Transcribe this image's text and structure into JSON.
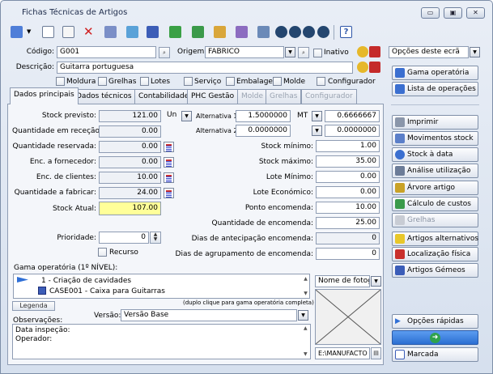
{
  "window": {
    "title": "Fichas Técnicas de Artigos",
    "btn_min": "▭",
    "btn_max": "▣",
    "btn_close": "✕"
  },
  "header": {
    "codigo_label": "Código:",
    "codigo_value": "G001",
    "origem_label": "Origem:",
    "origem_value": "FABRICO",
    "inativo_label": "Inativo",
    "descricao_label": "Descrição:",
    "descricao_value": "Guitarra portuguesa"
  },
  "flags": [
    "Moldura",
    "Grelhas",
    "Lotes",
    "Serviço",
    "Embalagem",
    "Molde",
    "Configurador"
  ],
  "tabs": [
    "Dados principais",
    "Dados técnicos",
    "Contabilidade",
    "PHC Gestão",
    "Molde",
    "Grelhas",
    "Configurador"
  ],
  "left_fields": [
    {
      "label": "Stock previsto:",
      "value": "121.00"
    },
    {
      "label": "Quantidade em receção:",
      "value": "0.00"
    },
    {
      "label": "Quantidade reservada:",
      "value": "0.00"
    },
    {
      "label": "Enc. a fornecedor:",
      "value": "0.00"
    },
    {
      "label": "Enc. de clientes:",
      "value": "10.00"
    },
    {
      "label": "Quantidade a fabricar:",
      "value": "24.00"
    },
    {
      "label": "Stock Atual:",
      "value": "107.00"
    }
  ],
  "unit": {
    "value": "Un",
    "alt1_label": "Alternativa 1:",
    "alt1_value": "1.5000000",
    "alt1_unit": "MT",
    "alt1_factor": "0.6666667",
    "alt2_label": "Alternativa 2:",
    "alt2_value": "0.0000000",
    "alt2_factor": "0.0000000"
  },
  "right_fields": [
    {
      "label": "Stock mínimo:",
      "value": "1.00"
    },
    {
      "label": "Stock máximo:",
      "value": "35.00"
    },
    {
      "label": "Lote Mínimo:",
      "value": "0.00"
    },
    {
      "label": "Lote Económico:",
      "value": "0.00"
    },
    {
      "label": "Ponto encomenda:",
      "value": "10.00"
    },
    {
      "label": "Quantidade de encomenda:",
      "value": "25.00"
    },
    {
      "label": "Dias de antecipação encomenda:",
      "value": "0"
    },
    {
      "label": "Dias de agrupamento de encomenda:",
      "value": "0"
    }
  ],
  "prioridade": {
    "label": "Prioridade:",
    "value": "0"
  },
  "recurso_label": "Recurso",
  "gama": {
    "label": "Gama operatória (1º NÍVEL):",
    "items": [
      "1 - Criação de cavidades",
      "CASE001 - Caixa para Guitarras"
    ],
    "legend_label": "Legenda",
    "hint": "(duplo clique para gama operatória completa)"
  },
  "versao": {
    "label": "Versão:",
    "value": "Versão Base"
  },
  "observacoes": {
    "label": "Observações:",
    "text_line1": "Data inspeção:",
    "text_line2": "Operador:"
  },
  "photo": {
    "label": "Nome de fotogr",
    "path": "E:\\MANUFACTO"
  },
  "side": {
    "options_label": "Opções deste ecrã",
    "buttons_top": [
      "Gama operatória",
      "Lista de operações"
    ],
    "buttons_main": [
      "Imprimir",
      "Movimentos stock",
      "Stock à data",
      "Análise utilização",
      "Árvore artigo",
      "Cálculo de custos",
      "Grelhas",
      "Artigos alternativos",
      "Localização física",
      "Artigos Gémeos"
    ],
    "quick_label": "Opções rápidas",
    "marcada_label": "Marcada"
  },
  "colors": {
    "accent": "#2f6fd6",
    "stock_highlight": "#ffff99"
  }
}
